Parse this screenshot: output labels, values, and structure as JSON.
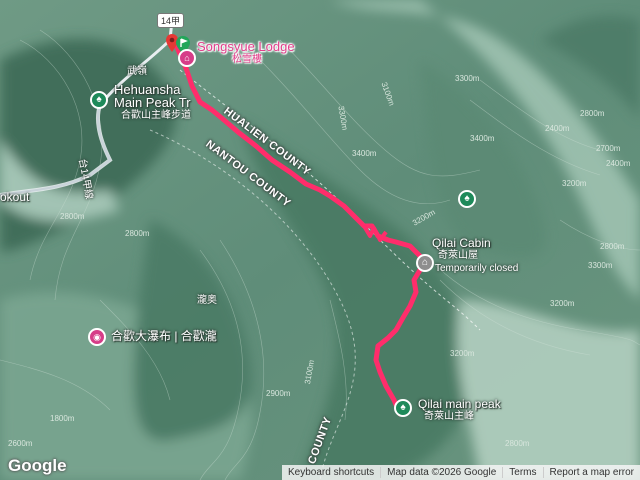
{
  "map": {
    "places": {
      "songsyue_en": "Songsyue Lodge",
      "songsyue_zh": "松雪樓",
      "hehuanshan_en_1": "Hehuansha",
      "hehuanshan_en_2": "Main Peak Tr",
      "hehuanshan_zh": "合歡山主峰步道",
      "wuling_zh": "武嶺",
      "cabin_en": "Qilai Cabin",
      "cabin_zh": "奇萊山屋",
      "cabin_status": "Temporarily closed",
      "peak_en": "Qilai main peak",
      "peak_zh": "奇萊山主峰",
      "waterfall": "合歡大瀑布 | 合歡瀧",
      "luanao_zh": "瀧奥",
      "lookout": "okout",
      "roadname_zh": "台14甲線"
    },
    "road_shield": "14甲",
    "county_labels": [
      "HUALIEN COUNTY",
      "NANTOU COUNTY",
      "COUNTY"
    ],
    "contour_labels": [
      "2800m",
      "2800m",
      "3200m",
      "3300m",
      "3400m",
      "3300m",
      "2800m",
      "3200m",
      "1800m",
      "2600m",
      "2400m",
      "2700m",
      "2400m",
      "2800m",
      "3200m",
      "3100m",
      "2900m",
      "3100m",
      "3400m",
      "3300m",
      "3200m",
      "2800m"
    ],
    "colors": {
      "route": "#ff2d6b",
      "terrain_dark": "#3f6b58",
      "terrain_light": "#9cbfae",
      "poi_green": "#1e8a5a",
      "poi_pink": "#d63d88"
    }
  },
  "footer": {
    "logo": "Google",
    "shortcuts": "Keyboard shortcuts",
    "map_data": "Map data ©2026 Google",
    "terms": "Terms",
    "report": "Report a map error"
  }
}
